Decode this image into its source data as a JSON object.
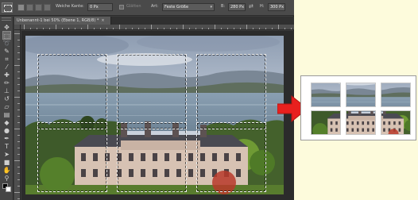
{
  "options_bar": {
    "feather_label": "Weiche Kante:",
    "feather_value": "0 Px",
    "antialias_label": "Glätten",
    "style_label": "Art:",
    "style_value": "Feste Größe",
    "width_label": "B:",
    "width_value": "280 Px",
    "height_label": "H:",
    "height_value": "300 Px"
  },
  "document": {
    "tab_title": "Unbenannt-1 bei 50% (Ebene 1, RGB/8) *",
    "close_glyph": "×"
  },
  "toolbar": {
    "tools": [
      {
        "icon": "move-icon",
        "glyph": "✥"
      },
      {
        "icon": "marquee-icon",
        "glyph": "⬚"
      },
      {
        "icon": "lasso-icon",
        "glyph": "➰"
      },
      {
        "icon": "quick-select-icon",
        "glyph": "✎"
      },
      {
        "icon": "crop-icon",
        "glyph": "⌗"
      },
      {
        "icon": "eyedropper-icon",
        "glyph": "⁄"
      },
      {
        "icon": "healing-brush-icon",
        "glyph": "✚"
      },
      {
        "icon": "brush-icon",
        "glyph": "✏"
      },
      {
        "icon": "clone-stamp-icon",
        "glyph": "⊥"
      },
      {
        "icon": "history-brush-icon",
        "glyph": "↺"
      },
      {
        "icon": "eraser-icon",
        "glyph": "▱"
      },
      {
        "icon": "gradient-icon",
        "glyph": "▤"
      },
      {
        "icon": "blur-icon",
        "glyph": "◆"
      },
      {
        "icon": "dodge-icon",
        "glyph": "●"
      },
      {
        "icon": "pen-icon",
        "glyph": "✒"
      },
      {
        "icon": "type-icon",
        "glyph": "T"
      },
      {
        "icon": "path-select-icon",
        "glyph": "➤"
      },
      {
        "icon": "shape-icon",
        "glyph": "■"
      },
      {
        "icon": "hand-icon",
        "glyph": "✋"
      },
      {
        "icon": "zoom-icon",
        "glyph": "⚲"
      }
    ],
    "active_tool": "marquee-icon"
  },
  "selection": {
    "grid_columns": 3,
    "grid_rows": 2
  },
  "result": {
    "tile_count": 6
  }
}
